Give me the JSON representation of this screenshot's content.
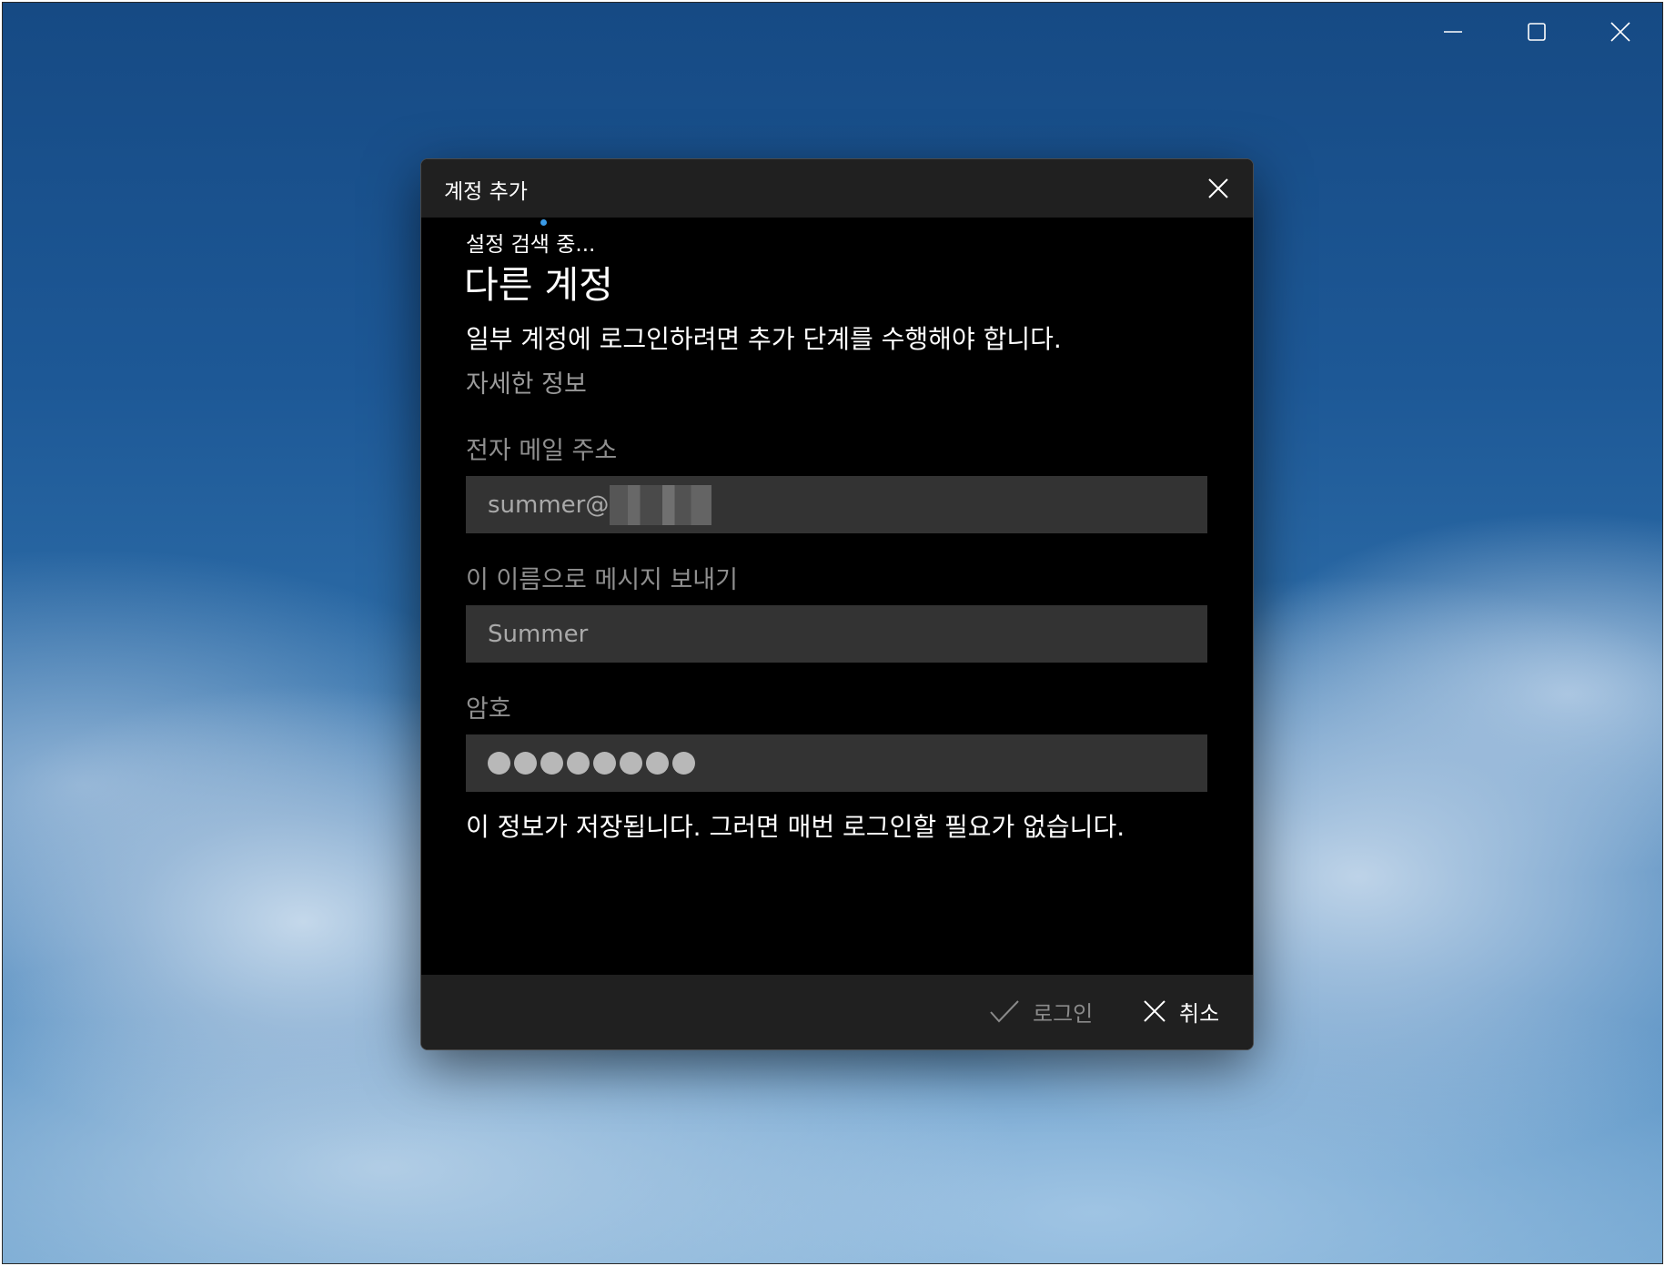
{
  "window": {
    "controls": [
      "minimize-icon",
      "maximize-icon",
      "close-icon"
    ]
  },
  "dialog": {
    "title": "계정 추가",
    "status": "설정 검색 중...",
    "heading": "다른 계정",
    "info": "일부 계정에 로그인하려면 추가 단계를 수행해야 합니다.",
    "more_info": "자세한 정보",
    "email": {
      "label": "전자 메일 주소",
      "value": "summer@"
    },
    "display_name": {
      "label": "이 이름으로 메시지 보내기",
      "value": "Summer"
    },
    "password": {
      "label": "암호",
      "masked_length": 8
    },
    "save_note": "이 정보가 저장됩니다. 그러면 매번 로그인할 필요가 없습니다.",
    "footer": {
      "login_label": "로그인",
      "cancel_label": "취소"
    }
  },
  "colors": {
    "dialog_bg": "#000000",
    "titlebar_bg": "#202020",
    "field_bg": "#333333",
    "accent": "#3a9be8"
  }
}
